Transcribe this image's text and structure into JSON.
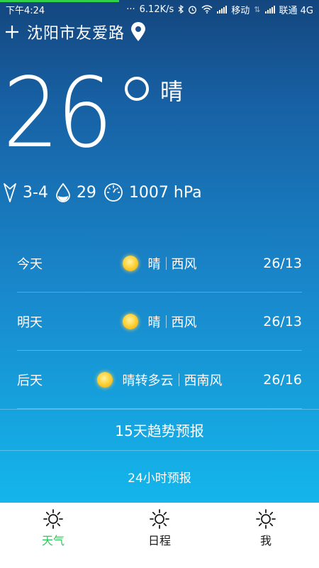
{
  "status_bar": {
    "time": "下午4:24",
    "speed": "6.12K/s",
    "carrier1": "移动",
    "carrier2": "联通 4G"
  },
  "header": {
    "city": "沈阳市友爱路"
  },
  "current": {
    "temperature": "26",
    "condition": "晴",
    "wind": "3-4",
    "humidity": "29",
    "pressure": "1007 hPa"
  },
  "forecast": [
    {
      "day": "今天",
      "weather": "晴",
      "wind": "西风",
      "range": "26/13"
    },
    {
      "day": "明天",
      "weather": "晴",
      "wind": "西风",
      "range": "26/13"
    },
    {
      "day": "后天",
      "weather": "晴转多云",
      "wind": "西南风",
      "range": "26/16"
    }
  ],
  "links": {
    "trend": "15天趋势预报",
    "hourly": "24小时预报"
  },
  "nav": {
    "weather": "天气",
    "schedule": "日程",
    "me": "我"
  },
  "colors": {
    "active_nav": "#2ec85a",
    "bg_top": "#14467e",
    "bg_bottom": "#14b6ec"
  }
}
